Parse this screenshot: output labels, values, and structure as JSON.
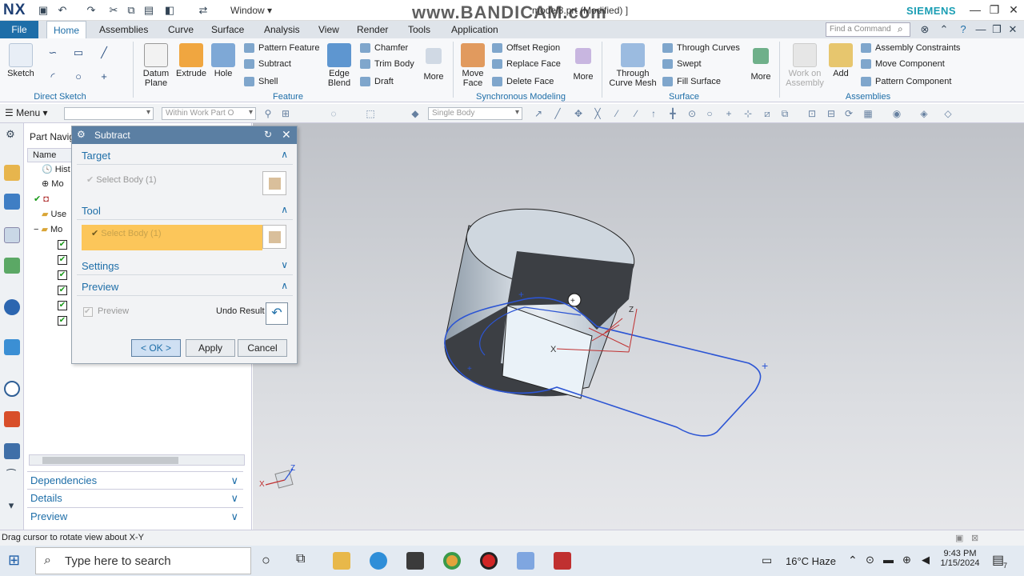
{
  "titlebar": {
    "logo": "NX",
    "window_menu": "Window",
    "file_title": "model8.prt (Modified) ]",
    "watermark": "www.BANDICAM.com",
    "brand": "SIEMENS"
  },
  "tabs": {
    "file": "File",
    "items": [
      "Home",
      "Assemblies",
      "Curve",
      "Surface",
      "Analysis",
      "View",
      "Render",
      "Tools",
      "Application"
    ],
    "active": "Home",
    "find_placeholder": "Find a Command"
  },
  "ribbon": {
    "direct_sketch": {
      "label": "Direct Sketch",
      "sketch": "Sketch"
    },
    "feature": {
      "label": "Feature",
      "datum": "Datum Plane",
      "extrude": "Extrude",
      "hole": "Hole",
      "pattern": "Pattern Feature",
      "subtract": "Subtract",
      "shell": "Shell",
      "edge_blend": "Edge Blend",
      "chamfer": "Chamfer",
      "trim_body": "Trim Body",
      "draft": "Draft",
      "more": "More"
    },
    "sync": {
      "label": "Synchronous Modeling",
      "move_face": "Move Face",
      "offset_region": "Offset Region",
      "replace_face": "Replace Face",
      "delete_face": "Delete Face",
      "more": "More"
    },
    "surface": {
      "label": "Surface",
      "through_curve_mesh": "Through Curve Mesh",
      "through_curves": "Through Curves",
      "swept": "Swept",
      "fill_surface": "Fill Surface",
      "more": "More"
    },
    "assemblies": {
      "label": "Assemblies",
      "work_on": "Work on Assembly",
      "add": "Add",
      "constraints": "Assembly Constraints",
      "move_component": "Move Component",
      "pattern_component": "Pattern Component"
    }
  },
  "selbar": {
    "menu": "Menu",
    "filter": "",
    "scope": "Within Work Part O",
    "body": "Single Body"
  },
  "navigator": {
    "title": "Part Navig",
    "column": "Name",
    "rows": [
      "Hist",
      "Mo",
      "",
      "Use",
      "Mo"
    ],
    "panels": [
      "Dependencies",
      "Details",
      "Preview"
    ]
  },
  "dialog": {
    "title": "Subtract",
    "target": {
      "label": "Target",
      "select": "Select Body (1)"
    },
    "tool": {
      "label": "Tool",
      "select": "Select Body (1)"
    },
    "settings": "Settings",
    "preview": {
      "label": "Preview",
      "check": "Preview",
      "undo": "Undo Result"
    },
    "ok": "< OK >",
    "apply": "Apply",
    "cancel": "Cancel"
  },
  "viewport": {
    "axis_x": "X",
    "axis_z": "Z",
    "triad_x": "X",
    "triad_z": "Z"
  },
  "status": {
    "text": "Drag cursor to rotate view about X-Y"
  },
  "taskbar": {
    "search": "Type here to search",
    "weather": "16°C  Haze",
    "time": "9:43 PM",
    "date": "1/15/2024",
    "notif": "7"
  },
  "colors": {
    "accent": "#1e6ea8",
    "dialog_title": "#5b7fa3",
    "highlight": "#fcc65a",
    "sketch_curve": "#2c55d4"
  }
}
